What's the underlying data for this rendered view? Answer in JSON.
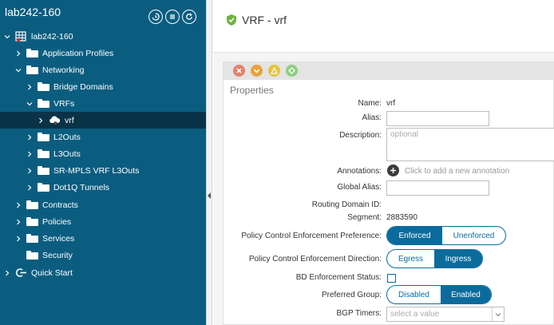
{
  "sidebar": {
    "title": "lab242-160",
    "header_icons": [
      "history-icon",
      "menu-list-icon",
      "refresh-icon"
    ],
    "tree": [
      {
        "label": "lab242-160",
        "icon": "tenant-icon",
        "expanded": true
      },
      {
        "label": "Application Profiles",
        "icon": "folder-icon",
        "expanded": false
      },
      {
        "label": "Networking",
        "icon": "folder-icon",
        "expanded": true
      },
      {
        "label": "Bridge Domains",
        "icon": "folder-icon",
        "expanded": false
      },
      {
        "label": "VRFs",
        "icon": "folder-icon",
        "expanded": true
      },
      {
        "label": "vrf",
        "icon": "vrf-cloud-icon",
        "expanded": false,
        "selected": true
      },
      {
        "label": "L2Outs",
        "icon": "folder-icon",
        "expanded": false
      },
      {
        "label": "L3Outs",
        "icon": "folder-icon",
        "expanded": false
      },
      {
        "label": "SR-MPLS VRF L3Outs",
        "icon": "folder-icon",
        "expanded": false
      },
      {
        "label": "Dot1Q Tunnels",
        "icon": "folder-icon",
        "expanded": false
      },
      {
        "label": "Contracts",
        "icon": "folder-icon",
        "expanded": false
      },
      {
        "label": "Policies",
        "icon": "folder-icon",
        "expanded": false
      },
      {
        "label": "Services",
        "icon": "folder-icon",
        "expanded": false
      },
      {
        "label": "Security",
        "icon": "folder-icon",
        "expanded": null
      },
      {
        "label": "Quick Start",
        "icon": "quick-start-icon",
        "expanded": false
      }
    ]
  },
  "header": {
    "title": "VRF - vrf",
    "icon": "shield-check-icon"
  },
  "actions": [
    {
      "name": "delete-icon",
      "color": "#e8806a"
    },
    {
      "name": "download-icon",
      "color": "#e9a33a"
    },
    {
      "name": "alert-icon",
      "color": "#e6c33a"
    },
    {
      "name": "health-icon",
      "color": "#8ccf7e"
    }
  ],
  "properties": {
    "title": "Properties",
    "name_label": "Name:",
    "name_value": "vrf",
    "alias_label": "Alias:",
    "description_label": "Description:",
    "description_placeholder": "optional",
    "annotations_label": "Annotations:",
    "annotations_hint": "Click to add a new annotation",
    "global_alias_label": "Global Alias:",
    "routing_domain_label": "Routing Domain ID:",
    "segment_label": "Segment:",
    "segment_value": "2883590",
    "pce_pref_label": "Policy Control Enforcement Preference:",
    "pce_pref_options": [
      "Enforced",
      "Unenforced"
    ],
    "pce_pref_selected": "Enforced",
    "pce_dir_label": "Policy Control Enforcement Direction:",
    "pce_dir_options": [
      "Egress",
      "Ingress"
    ],
    "pce_dir_selected": "Ingress",
    "bd_enf_label": "BD Enforcement Status:",
    "bd_enf_checked": false,
    "pref_group_label": "Preferred Group:",
    "pref_group_options": [
      "Disabled",
      "Enabled"
    ],
    "pref_group_selected": "Enabled",
    "bgp_timers_label": "BGP Timers:",
    "bgp_timers_placeholder": "select a value"
  },
  "colors": {
    "sidebar_bg": "#0b5d80",
    "selected_bg": "#0a3348",
    "accent": "#0b6b9d"
  }
}
